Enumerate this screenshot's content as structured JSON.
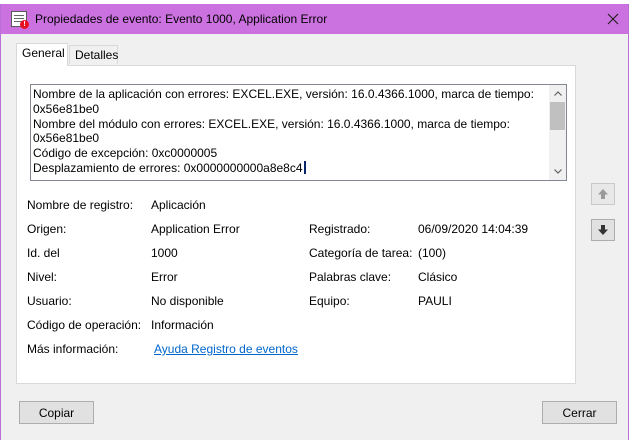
{
  "window": {
    "title": "Propiedades de evento: Evento 1000, Application Error"
  },
  "tabs": [
    {
      "label": "General"
    },
    {
      "label": "Detalles"
    }
  ],
  "description": {
    "lines": [
      "Nombre de la aplicación con errores: EXCEL.EXE, versión: 16.0.4366.1000, marca de tiempo:",
      "0x56e81be0",
      "Nombre del módulo con errores: EXCEL.EXE, versión: 16.0.4366.1000, marca de tiempo:",
      "0x56e81be0",
      "Código de excepción: 0xc0000005",
      "Desplazamiento de errores: 0x0000000000a8e8c4"
    ]
  },
  "fields": {
    "log_name": {
      "label": "Nombre de registro:",
      "value": "Aplicación"
    },
    "source": {
      "label": "Origen:",
      "value": "Application Error"
    },
    "logged": {
      "label": "Registrado:",
      "value": "06/09/2020 14:04:39"
    },
    "event_id": {
      "label": "Id. del",
      "value": "1000"
    },
    "task_category": {
      "label": "Categoría de tarea:",
      "value": "(100)"
    },
    "level": {
      "label": "Nivel:",
      "value": "Error"
    },
    "keywords": {
      "label": "Palabras clave:",
      "value": "Clásico"
    },
    "user": {
      "label": "Usuario:",
      "value": "No disponible"
    },
    "computer": {
      "label": "Equipo:",
      "value": "PAULI"
    },
    "opcode": {
      "label": "Código de operación:",
      "value": "Información"
    },
    "more_info": {
      "label": "Más información:",
      "link": "Ayuda Registro de eventos"
    }
  },
  "buttons": {
    "copy": "Copiar",
    "close": "Cerrar"
  },
  "icons": {
    "up": "arrow-up-icon",
    "down": "arrow-down-icon",
    "close": "close-icon"
  },
  "colors": {
    "titlebar": "#cc72e0",
    "link": "#0066cc"
  }
}
